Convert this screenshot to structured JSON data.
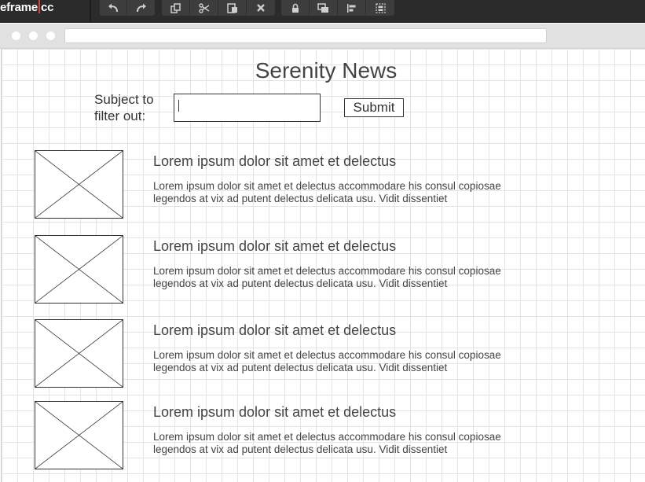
{
  "app": {
    "logo_text": "eframe",
    "logo_suffix": "cc"
  },
  "toolbar_groups": [
    {
      "group": "history",
      "buttons": [
        "undo-icon",
        "redo-icon"
      ]
    },
    {
      "group": "clipboard",
      "buttons": [
        "duplicate-icon",
        "cut-icon",
        "paste-icon",
        "delete-icon"
      ]
    },
    {
      "group": "arrange",
      "buttons": [
        "lock-icon",
        "bring-front-icon",
        "align-icon",
        "group-icon"
      ]
    }
  ],
  "page": {
    "title": "Serenity News",
    "filter_label": "Subject to filter out:",
    "filter_value": "",
    "submit_label": "Submit"
  },
  "news": [
    {
      "headline": "Lorem ipsum dolor sit amet et delectus",
      "summary": "Lorem ipsum dolor sit amet et delectus accommodare his consul copiosae legendos at vix ad putent delectus delicata usu. Vidit dissentiet"
    },
    {
      "headline": "Lorem ipsum dolor sit amet et delectus",
      "summary": "Lorem ipsum dolor sit amet et delectus accommodare his consul copiosae legendos at vix ad putent delectus delicata usu. Vidit dissentiet"
    },
    {
      "headline": "Lorem ipsum dolor sit amet et delectus",
      "summary": "Lorem ipsum dolor sit amet et delectus accommodare his consul copiosae legendos at vix ad putent delectus delicata usu. Vidit dissentiet"
    },
    {
      "headline": "Lorem ipsum dolor sit amet et delectus",
      "summary": "Lorem ipsum dolor sit amet et delectus accommodare his consul copiosae legendos at vix ad putent delectus delicata usu. Vidit dissentiet"
    }
  ],
  "colors": {
    "toolbar_bg": "#2b2b2b",
    "logo_accent": "#d8413a",
    "text": "#444444",
    "grid": "#e4e4e4"
  }
}
